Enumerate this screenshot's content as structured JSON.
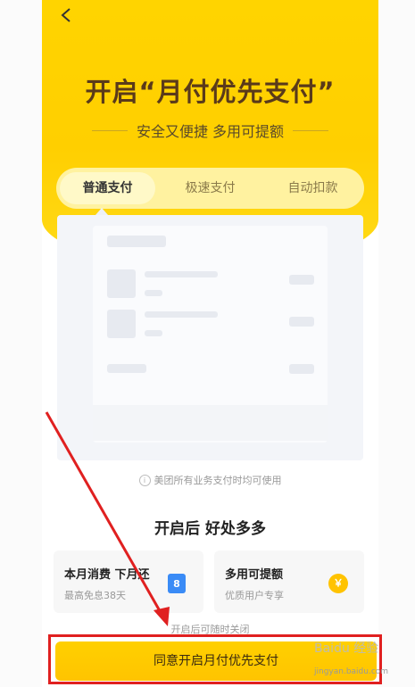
{
  "hero": {
    "back_icon": "chevron-left-icon",
    "title": "开启“月付优先支付”",
    "subtitle": "安全又便捷 多用可提额"
  },
  "tabs": [
    {
      "label": "普通支付",
      "active": true
    },
    {
      "label": "极速支付",
      "active": false
    },
    {
      "label": "自动扣款",
      "active": false
    }
  ],
  "info": {
    "icon": "info-icon",
    "text": "美团所有业务支付时均可使用"
  },
  "benefits": {
    "title": "开启后  好处多多",
    "cards": [
      {
        "title": "本月消费 下月还",
        "subtitle": "最高免息38天",
        "icon": "calendar-icon",
        "icon_text": "8"
      },
      {
        "title": "多用可提额",
        "subtitle": "优质用户专享",
        "icon": "coin-icon",
        "icon_text": "￥"
      }
    ]
  },
  "footer": {
    "close_note": "开启后可随时关闭",
    "cta_label": "同意开启月付优先支付"
  },
  "watermark": {
    "brand": "Baidu 经验",
    "url": "jingyan.baidu.com"
  },
  "colors": {
    "brand_yellow": "#ffd400",
    "annotation_red": "#e02020",
    "calendar_blue": "#3a8bf6"
  }
}
